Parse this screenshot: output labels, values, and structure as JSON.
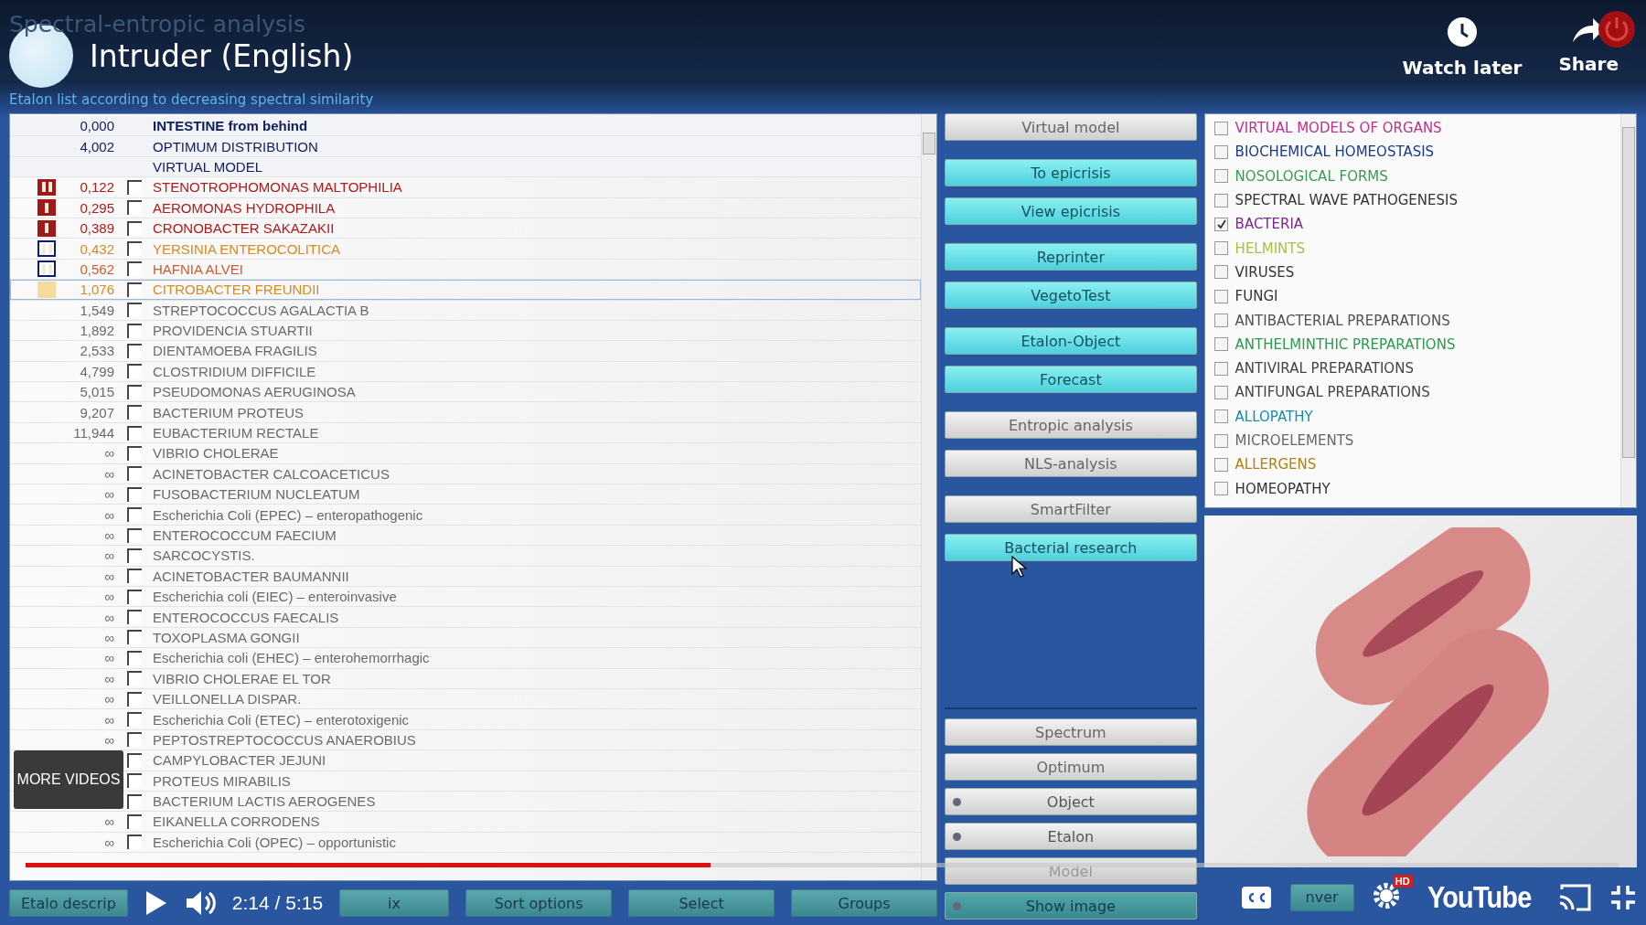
{
  "video": {
    "faded_title": "Spectral-entropic analysis",
    "title": "Intruder (English)",
    "actions": [
      {
        "label": "Watch later",
        "kind": "clock"
      },
      {
        "label": "Share",
        "kind": "share"
      }
    ],
    "more_videos": "MORE VIDEOS",
    "time": "2:14 / 5:15",
    "progress": {
      "level": 0.43
    },
    "hd_badge": "HD",
    "brand": "YouTube"
  },
  "subtitle": "Etalon list according to decreasing spectral similarity",
  "etalons": [
    {
      "kind": "title",
      "value": "0,000",
      "name": "INTESTINE from behind",
      "color": "#101c5c",
      "selected": false
    },
    {
      "kind": "summary",
      "value": "4,002",
      "name": "OPTIMUM DISTRIBUTION",
      "color": "#101c5c",
      "selected": false
    },
    {
      "kind": "summary",
      "name": "VIRTUAL MODEL",
      "color": "#101c5c",
      "selected": false
    },
    {
      "kind": "etalon",
      "marker": {
        "kind": "double-red"
      },
      "value": "0,122",
      "name": "STENOTROPHOMONAS MALTOPHILIA",
      "color": "#b01a1a",
      "selected": false
    },
    {
      "kind": "etalon",
      "marker": {
        "kind": "single-red"
      },
      "value": "0,295",
      "name": "AEROMONAS HYDROPHILA",
      "color": "#b01a1a",
      "selected": false
    },
    {
      "kind": "etalon",
      "marker": {
        "kind": "single-red"
      },
      "value": "0,389",
      "name": "CRONOBACTER SAKAZAKII",
      "color": "#b01a1a",
      "selected": false
    },
    {
      "kind": "etalon",
      "marker": {
        "kind": "double-blue"
      },
      "value": "0,432",
      "name": "YERSINIA ENTEROCOLITICA",
      "color": "#d98a20",
      "selected": false
    },
    {
      "kind": "etalon",
      "marker": {
        "kind": "double-blue"
      },
      "value": "0,562",
      "name": "HAFNIA ALVEI",
      "color": "#d05a30",
      "selected": false
    },
    {
      "kind": "etalon",
      "marker": {
        "kind": "block-yellow"
      },
      "value": "1,076",
      "name": "CITROBACTER FREUNDII",
      "color": "#d98a20",
      "selected": true
    },
    {
      "kind": "etalon",
      "value": "1,549",
      "name": "STREPTOCOCCUS  AGALACTIA  B",
      "color": "#6a6a6a",
      "selected": false
    },
    {
      "kind": "etalon",
      "value": "1,892",
      "name": "PROVIDENCIA STUARTII",
      "color": "#6a6a6a",
      "selected": false
    },
    {
      "kind": "etalon",
      "value": "2,533",
      "name": "DIENTAMOEBA FRAGILIS",
      "color": "#6a6a6a",
      "selected": false
    },
    {
      "kind": "etalon",
      "value": "4,799",
      "name": "CLOSTRIDIUM DIFFICILE",
      "color": "#6a6a6a",
      "selected": false
    },
    {
      "kind": "etalon",
      "value": "5,015",
      "name": "PSEUDOMONAS  AERUGINOSA",
      "color": "#6a6a6a",
      "selected": false
    },
    {
      "kind": "etalon",
      "value": "9,207",
      "name": "BACTERIUM  PROTEUS",
      "color": "#6a6a6a",
      "selected": false
    },
    {
      "kind": "etalon",
      "value": "11,944",
      "name": "EUBACTERIUM RECTALE",
      "color": "#6a6a6a",
      "selected": false
    },
    {
      "kind": "etalon",
      "value": "∞",
      "name": "VIBRIO CHOLERAE",
      "color": "#6a6a6a",
      "selected": false
    },
    {
      "kind": "etalon",
      "value": "∞",
      "name": "ACINETOBACTER CALCOACETICUS",
      "color": "#6a6a6a",
      "selected": false
    },
    {
      "kind": "etalon",
      "value": "∞",
      "name": "FUSOBACTERIUM NUCLEATUM",
      "color": "#6a6a6a",
      "selected": false
    },
    {
      "kind": "etalon",
      "value": "∞",
      "name": "Escherichia Coli (EPEC) – enteropathogenic",
      "color": "#6a6a6a",
      "selected": false
    },
    {
      "kind": "etalon",
      "value": "∞",
      "name": "ENTEROCOCCUM  FAECIUM",
      "color": "#6a6a6a",
      "selected": false
    },
    {
      "kind": "etalon",
      "value": "∞",
      "name": "SARCOCYSTIS.",
      "color": "#6a6a6a",
      "selected": false
    },
    {
      "kind": "etalon",
      "value": "∞",
      "name": "ACINETOBACTER BAUMANNII",
      "color": "#6a6a6a",
      "selected": false
    },
    {
      "kind": "etalon",
      "value": "∞",
      "name": "Escherichia coli (EIEC) – enteroinvasive",
      "color": "#6a6a6a",
      "selected": false
    },
    {
      "kind": "etalon",
      "value": "∞",
      "name": "ENTEROCOCCUS FAECALIS",
      "color": "#6a6a6a",
      "selected": false
    },
    {
      "kind": "etalon",
      "value": "∞",
      "name": "TOXOPLASMA  GONGII",
      "color": "#6a6a6a",
      "selected": false
    },
    {
      "kind": "etalon",
      "value": "∞",
      "name": "Escherichia coli (EHEC) – enterohemorrhagic",
      "color": "#6a6a6a",
      "selected": false
    },
    {
      "kind": "etalon",
      "value": "∞",
      "name": "VIBRIO CHOLERAE EL TOR",
      "color": "#6a6a6a",
      "selected": false
    },
    {
      "kind": "etalon",
      "value": "∞",
      "name": "VEILLONELLA DISPAR.",
      "color": "#6a6a6a",
      "selected": false
    },
    {
      "kind": "etalon",
      "value": "∞",
      "name": "Escherichia Coli (ETEC) – enterotoxigenic",
      "color": "#6a6a6a",
      "selected": false
    },
    {
      "kind": "etalon",
      "value": "∞",
      "name": "PEPTOSTREPTOCOCCUS ANAEROBIUS",
      "color": "#6a6a6a",
      "selected": false
    },
    {
      "kind": "etalon",
      "name": "CAMPYLOBACTER JEJUNI",
      "color": "#6a6a6a",
      "selected": false
    },
    {
      "kind": "etalon",
      "name": "PROTEUS MIRABILIS",
      "color": "#6a6a6a",
      "selected": false
    },
    {
      "kind": "etalon",
      "name": "BACTERIUM  LACTIS  AEROGENES",
      "color": "#6a6a6a",
      "selected": false
    },
    {
      "kind": "etalon",
      "value": "∞",
      "name": "EIKANELLA CORRODENS",
      "color": "#6a6a6a",
      "selected": false
    },
    {
      "kind": "etalon",
      "value": "∞",
      "name": "Escherichia Coli (OPEC) – opportunistic",
      "color": "#6a6a6a",
      "selected": false
    }
  ],
  "bottom_buttons": [
    "Etalo descrip",
    "ix",
    "Sort options",
    "Select",
    "Groups"
  ],
  "action_groups": [
    [
      {
        "label": "Virtual model",
        "kind": "gray"
      }
    ],
    [
      {
        "label": "To epicrisis",
        "kind": "cyan"
      },
      {
        "label": "View epicrisis",
        "kind": "cyan"
      }
    ],
    [
      {
        "label": "Reprinter",
        "kind": "cyan"
      },
      {
        "label": "VegetoTest",
        "kind": "cyan"
      }
    ],
    [
      {
        "label": "Etalon-Object",
        "kind": "cyan"
      },
      {
        "label": "Forecast",
        "kind": "cyan"
      }
    ],
    [
      {
        "label": "Entropic analysis",
        "kind": "gray"
      },
      {
        "label": "NLS-analysis",
        "kind": "gray"
      }
    ],
    [
      {
        "label": "SmartFilter",
        "kind": "gray"
      },
      {
        "label": "Bacterial research",
        "kind": "cyan"
      }
    ]
  ],
  "view_buttons": [
    {
      "label": "Spectrum",
      "kind": "gray"
    },
    {
      "label": "Optimum",
      "kind": "gray"
    },
    {
      "label": "Object",
      "kind": "radio"
    },
    {
      "label": "Etalon",
      "kind": "radio"
    },
    {
      "label": "Model",
      "kind": "dim"
    },
    {
      "label": "Show image",
      "kind": "teal-radio"
    }
  ],
  "categories": [
    {
      "label": "VIRTUAL MODELS OF ORGANS",
      "color": "#c0308a",
      "checked": false
    },
    {
      "label": "BIOCHEMICAL HOMEOSTASIS",
      "color": "#1a3a8a",
      "checked": false
    },
    {
      "label": "NOSOLOGICAL FORMS",
      "color": "#3a9a5a",
      "checked": false
    },
    {
      "label": "SPECTRAL WAVE PATHOGENESIS",
      "color": "#333333",
      "checked": false
    },
    {
      "label": "BACTERIA",
      "color": "#7a2a8a",
      "checked": true
    },
    {
      "label": "HELMINTS",
      "color": "#a8c040",
      "checked": false
    },
    {
      "label": "VIRUSES",
      "color": "#333333",
      "checked": false
    },
    {
      "label": "FUNGI",
      "color": "#333333",
      "checked": false
    },
    {
      "label": "ANTIBACTERIAL PREPARATIONS",
      "color": "#505050",
      "checked": false
    },
    {
      "label": "ANTHELMINTHIC PREPARATIONS",
      "color": "#2a9a50",
      "checked": false
    },
    {
      "label": "ANTIVIRAL PREPARATIONS",
      "color": "#444444",
      "checked": false
    },
    {
      "label": "ANTIFUNGAL PREPARATIONS",
      "color": "#444444",
      "checked": false
    },
    {
      "label": "ALLOPATHY",
      "color": "#1a8ab0",
      "checked": false
    },
    {
      "label": "MICROELEMENTS",
      "color": "#666666",
      "checked": false
    },
    {
      "label": "ALLERGENS",
      "color": "#b08010",
      "checked": false
    },
    {
      "label": "HOMEOPATHY",
      "color": "#333333",
      "checked": false
    }
  ],
  "image_button": "nver"
}
